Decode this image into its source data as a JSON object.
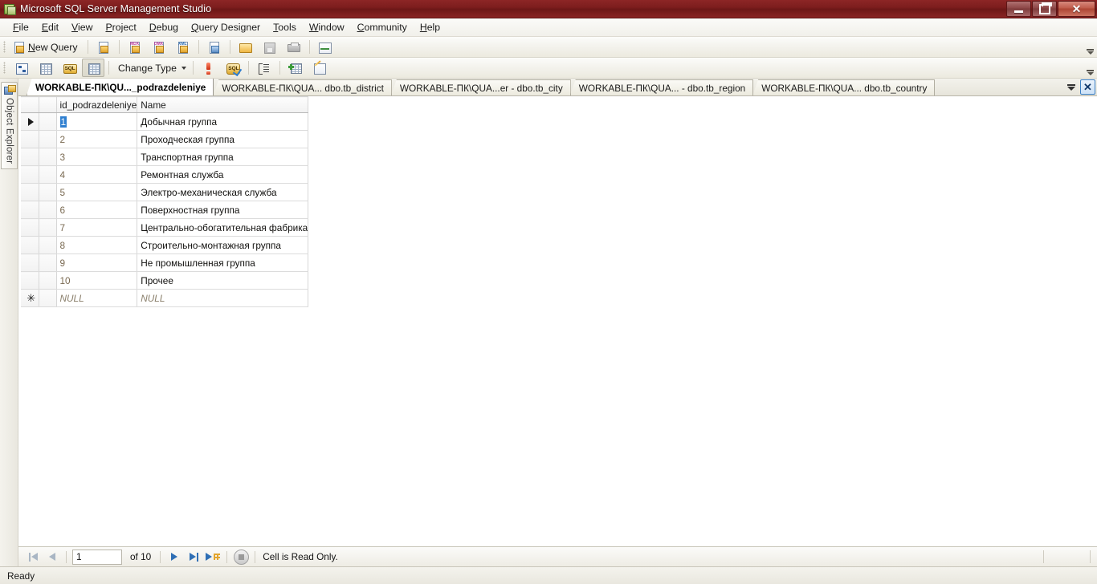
{
  "window": {
    "title": "Microsoft SQL Server Management Studio",
    "app_icon": "ssms-icon",
    "controls": {
      "minimize": "minimize-button",
      "maximize": "maximize-button",
      "close": "close-button"
    }
  },
  "menu": {
    "items": [
      {
        "label": "File",
        "accel": "F"
      },
      {
        "label": "Edit",
        "accel": "E"
      },
      {
        "label": "View",
        "accel": "V"
      },
      {
        "label": "Project",
        "accel": "P"
      },
      {
        "label": "Debug",
        "accel": "D"
      },
      {
        "label": "Query Designer",
        "accel": "Q"
      },
      {
        "label": "Tools",
        "accel": "T"
      },
      {
        "label": "Window",
        "accel": "W"
      },
      {
        "label": "Community",
        "accel": "C"
      },
      {
        "label": "Help",
        "accel": "H"
      }
    ]
  },
  "toolbar_main": {
    "new_query_label": "New Query",
    "new_query_accel": "N",
    "buttons": [
      {
        "name": "new-query-button",
        "icon": "new-query-icon"
      },
      {
        "name": "new-database-engine-query",
        "icon": "page-gold-icon"
      },
      {
        "name": "new-analysis-services-mdx",
        "icon": "mdx-query-icon",
        "tag": "MDX"
      },
      {
        "name": "new-analysis-services-dmx",
        "icon": "dmx-query-icon",
        "tag": "DMX"
      },
      {
        "name": "new-analysis-services-xmla",
        "icon": "xmla-query-icon",
        "tag": "XMLA"
      },
      {
        "name": "new-sql-server-compact-query",
        "icon": "page-blue-icon"
      },
      {
        "name": "open-file-button",
        "icon": "open-folder-icon"
      },
      {
        "name": "save-button",
        "icon": "save-disk-icon"
      },
      {
        "name": "print-button",
        "icon": "printer-icon"
      },
      {
        "name": "activity-monitor-button",
        "icon": "activity-monitor-icon"
      }
    ],
    "overflow": "toolbar-overflow-icon"
  },
  "toolbar_query": {
    "change_type_label": "Change Type",
    "buttons": [
      {
        "name": "show-diagram-pane-button",
        "icon": "diagram-pane-icon"
      },
      {
        "name": "show-criteria-pane-button",
        "icon": "criteria-pane-icon"
      },
      {
        "name": "show-sql-pane-button",
        "icon": "sql-pane-icon",
        "tag": "SQL"
      },
      {
        "name": "show-results-pane-button",
        "icon": "results-pane-icon",
        "pressed": true
      },
      {
        "name": "execute-sql-button",
        "icon": "execute-exclamation-icon"
      },
      {
        "name": "verify-sql-syntax-button",
        "icon": "verify-sql-icon",
        "tag": "SQL"
      },
      {
        "name": "add-group-by-button",
        "icon": "group-by-icon"
      },
      {
        "name": "add-table-button",
        "icon": "add-table-icon"
      },
      {
        "name": "add-new-derived-table-button",
        "icon": "add-derived-table-icon"
      }
    ],
    "overflow": "toolbar-overflow-icon"
  },
  "object_explorer": {
    "label": "Object Explorer",
    "icon": "object-explorer-icon"
  },
  "tabs": {
    "items": [
      {
        "label": "WORKABLE-ПК\\QU..._podrazdeleniye",
        "active": true
      },
      {
        "label": "WORKABLE-ПК\\QUA... dbo.tb_district",
        "active": false
      },
      {
        "label": "WORKABLE-ПК\\QUA...er - dbo.tb_city",
        "active": false
      },
      {
        "label": "WORKABLE-ПК\\QUA... - dbo.tb_region",
        "active": false
      },
      {
        "label": "WORKABLE-ПК\\QUA... dbo.tb_country",
        "active": false
      }
    ],
    "dropdown_icon": "tab-list-dropdown-icon",
    "close_icon": "close-tab-icon"
  },
  "grid": {
    "columns": [
      "id_podrazdeleniye",
      "Name"
    ],
    "selected_cell": {
      "row": 0,
      "column": 0
    },
    "rows": [
      {
        "id": "1",
        "name": "Добычная группа",
        "current": true
      },
      {
        "id": "2",
        "name": "Проходческая группа",
        "current": false
      },
      {
        "id": "3",
        "name": "Транспортная группа",
        "current": false
      },
      {
        "id": "4",
        "name": "Ремонтная служба",
        "current": false
      },
      {
        "id": "5",
        "name": "Электро-механическая служба",
        "current": false
      },
      {
        "id": "6",
        "name": "Поверхностная группа",
        "current": false
      },
      {
        "id": "7",
        "name": "Центрально-обогатительная фабрика",
        "current": false
      },
      {
        "id": "8",
        "name": "Строительно-монтажная группа",
        "current": false
      },
      {
        "id": "9",
        "name": "Не промышленная группа",
        "current": false
      },
      {
        "id": "10",
        "name": "Прочее",
        "current": false
      }
    ],
    "new_row": {
      "id": "NULL",
      "name": "NULL",
      "marker": "new-row-star-icon"
    },
    "row_marker_icon": "current-row-arrow-icon"
  },
  "navigation": {
    "first_icon": "move-first-icon",
    "previous_icon": "move-previous-icon",
    "row_number": "1",
    "of_label": "of 10",
    "next_icon": "move-next-icon",
    "last_icon": "move-last-icon",
    "new_row_icon": "move-to-new-row-icon",
    "stop_icon": "stop-icon",
    "message": "Cell is Read Only."
  },
  "status": {
    "text": "Ready"
  },
  "colors": {
    "title_bar": "#7c1d1d",
    "selection": "#2f7fd0",
    "toolbar_bg": "#f3f2ec",
    "grid_bg": "#ffffff",
    "id_text": "#7a6a52",
    "null_text": "#8a7f6b"
  }
}
